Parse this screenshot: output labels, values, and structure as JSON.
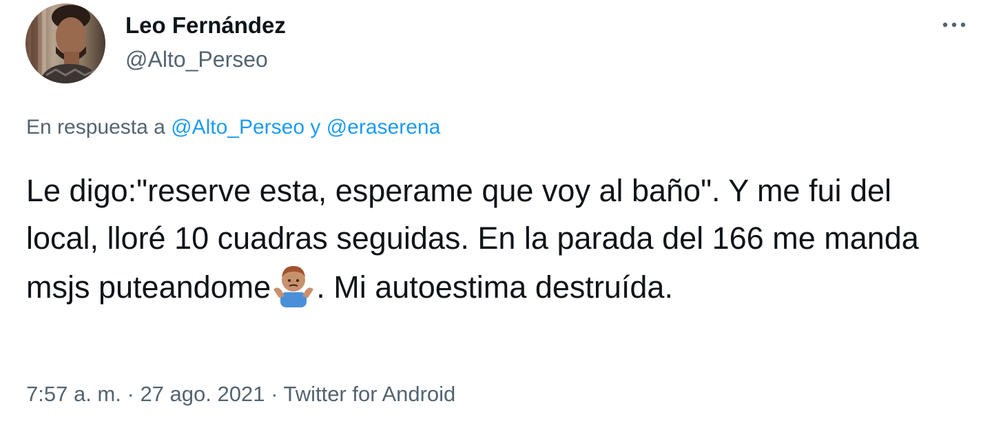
{
  "author": {
    "name": "Leo Fernández",
    "handle": "@Alto_Perseo"
  },
  "reply": {
    "prefix": "En respuesta a",
    "mention_1": "@Alto_Perseo",
    "conjunction": "y",
    "mention_2": "@eraserena"
  },
  "tweet": {
    "text_before_emoji": "Le digo:\"reserve esta, esperame que voy al baño\". Y me fui del local, lloré 10 cuadras seguidas. En la parada del 166 me manda msjs puteandome",
    "emoji": "person-shrugging-emoji",
    "text_after_emoji": ". Mi autoestima destruída."
  },
  "meta": {
    "time": "7:57 a. m.",
    "separator_1": "·",
    "date": "27 ago. 2021",
    "separator_2": "·",
    "source": "Twitter for Android"
  },
  "icons": {
    "more": "more-horizontal-icon",
    "avatar": "avatar"
  },
  "colors": {
    "text": "#0f1419",
    "secondary": "#536471",
    "link": "#1d9bf0"
  }
}
